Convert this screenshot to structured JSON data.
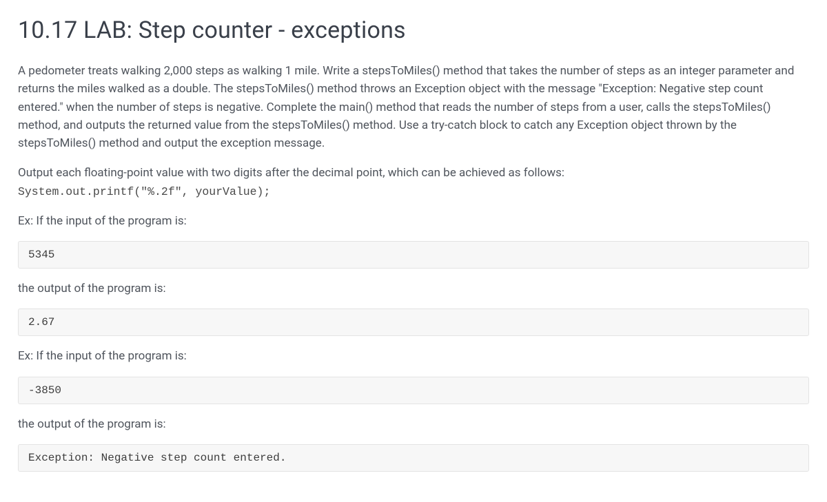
{
  "title": "10.17 LAB: Step counter - exceptions",
  "paragraph_main": "A pedometer treats walking 2,000 steps as walking 1 mile. Write a stepsToMiles() method that takes the number of steps as an integer parameter and returns the miles walked as a double. The stepsToMiles() method throws an Exception object with the message \"Exception: Negative step count entered.\" when the number of steps is negative. Complete the main() method that reads the number of steps from a user, calls the stepsToMiles() method, and outputs the returned value from the stepsToMiles() method. Use a try-catch block to catch any Exception object thrown by the stepsToMiles() method and output the exception message.",
  "paragraph_output_hint": "Output each floating-point value with two digits after the decimal point, which can be achieved as follows:",
  "code_printf": "System.out.printf(\"%.2f\", yourValue);",
  "ex1_input_label": "Ex: If the input of the program is:",
  "ex1_input_value": "5345",
  "ex1_output_label": "the output of the program is:",
  "ex1_output_value": "2.67",
  "ex2_input_label": "Ex: If the input of the program is:",
  "ex2_input_value": "-3850",
  "ex2_output_label": "the output of the program is:",
  "ex2_output_value": "Exception: Negative step count entered."
}
